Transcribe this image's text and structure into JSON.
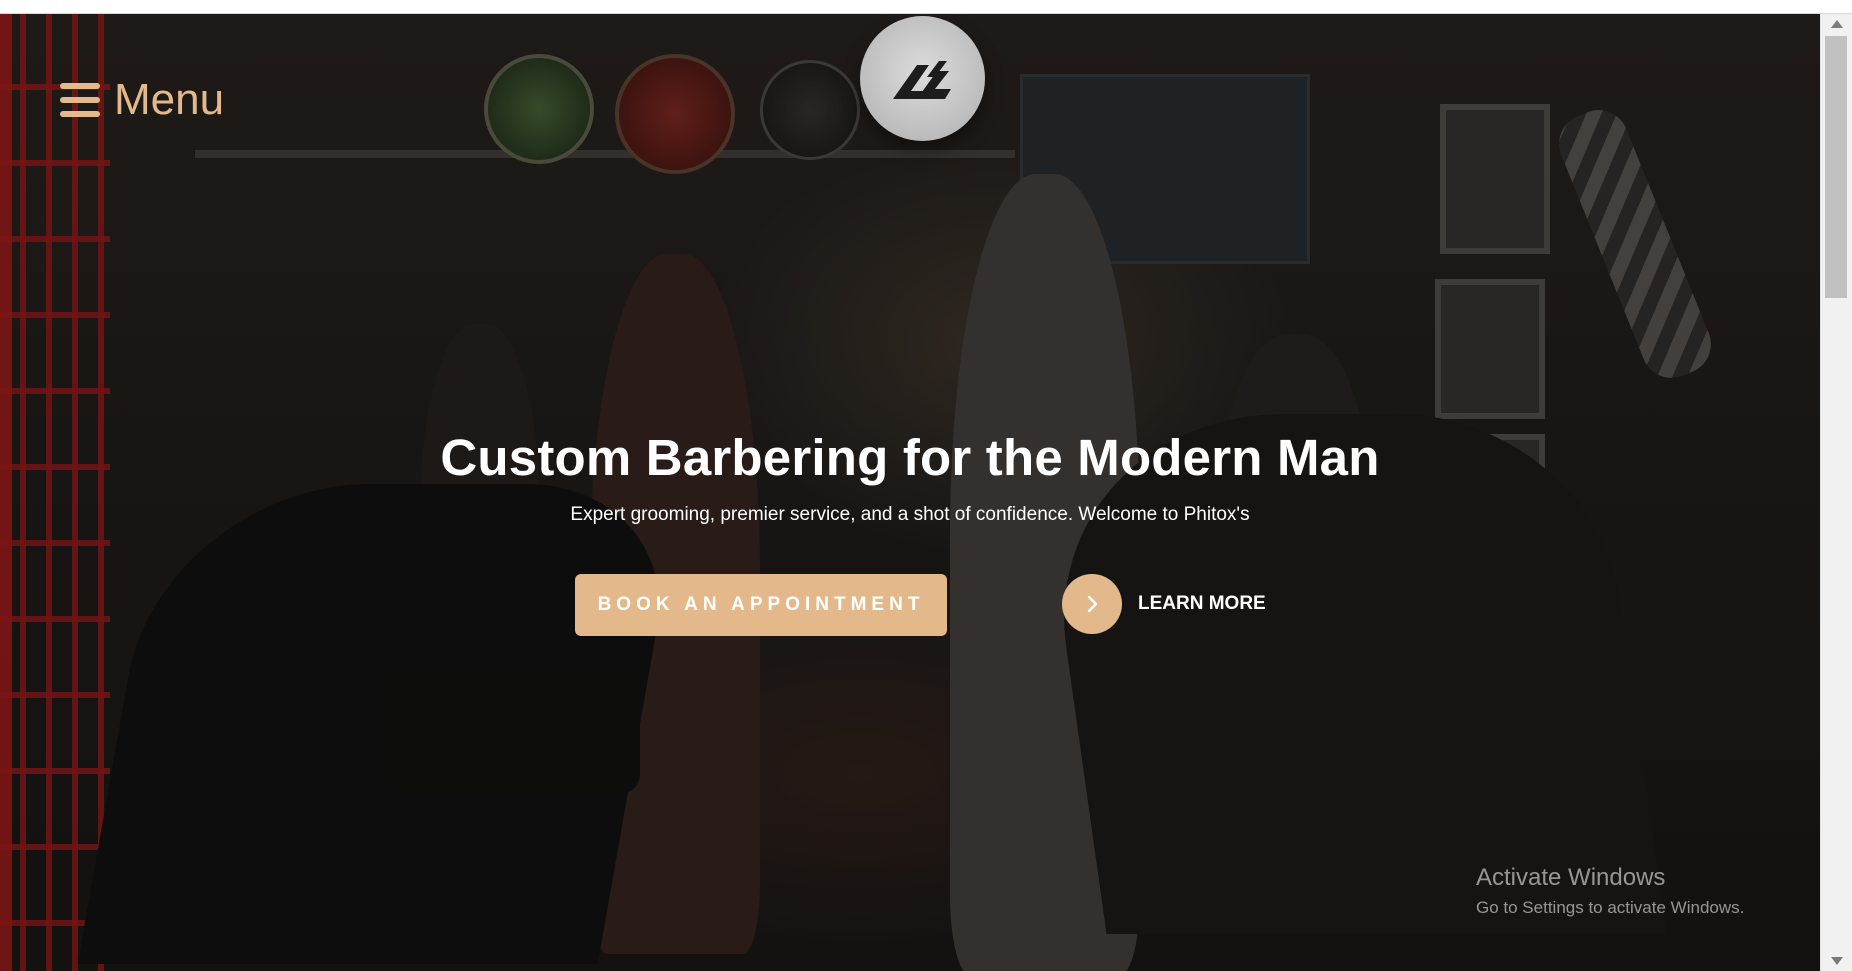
{
  "nav": {
    "menu_label": "Menu",
    "menu_icon": "hamburger-icon",
    "logo_icon": "brand-logo"
  },
  "hero": {
    "headline": "Custom Barbering for the Modern Man",
    "subline": "Expert grooming, premier service, and a shot of confidence. Welcome to Phitox's",
    "book_button": "BOOK AN APPOINTMENT",
    "learn_more": "LEARN MORE",
    "learn_icon": "chevron-right-icon"
  },
  "os_watermark": {
    "title": "Activate Windows",
    "subtitle": "Go to Settings to activate Windows."
  },
  "colors": {
    "accent": "#e3b98c",
    "text": "#ffffff",
    "background": "#23201d"
  }
}
